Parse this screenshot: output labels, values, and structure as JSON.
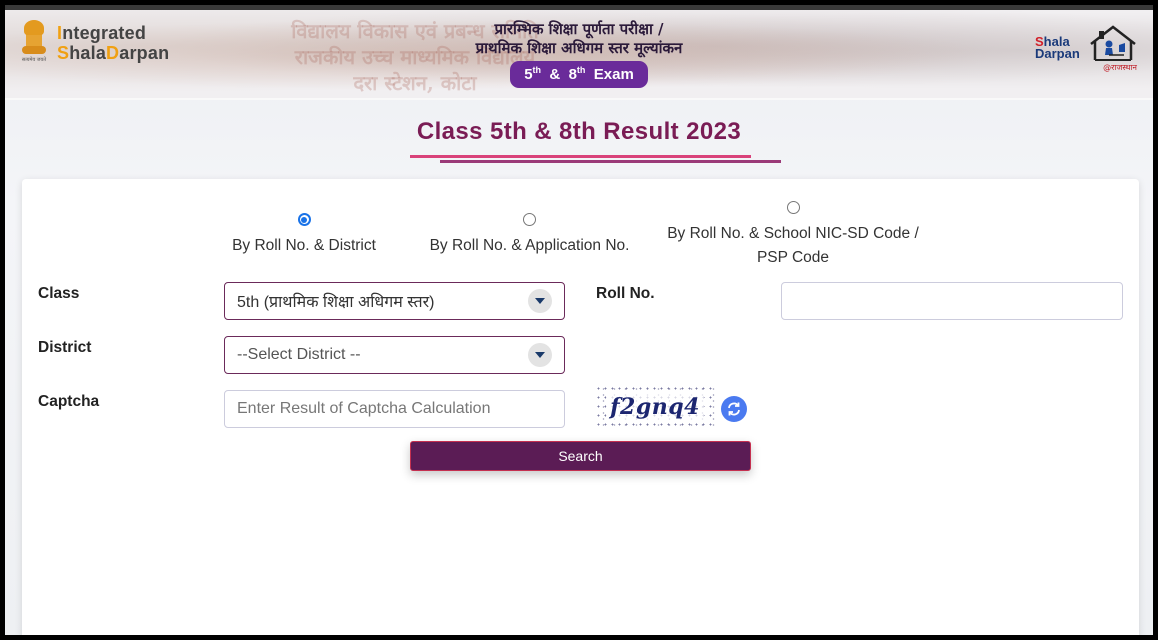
{
  "header": {
    "brand_line1_accent": "I",
    "brand_line1_rest": "ntegrated",
    "brand_line2_accent1": "S",
    "brand_line2_mid": "hala",
    "brand_line2_accent2": "D",
    "brand_line2_rest": "arpan",
    "emblem_caption": "सत्यमेव जयते",
    "hindi_title_line1": "प्रारम्भिक शिक्षा पूर्णता परीक्षा /",
    "hindi_title_line2": "प्राथमिक शिक्षा अधिगम स्तर मूल्यांकन",
    "exam_badge": {
      "n1": "5",
      "sup1": "th",
      "amp": "&",
      "n2": "8",
      "sup2": "th",
      "word": "Exam"
    },
    "right_logo": {
      "s": "S",
      "hala": "hala",
      "darpan": "Darpan",
      "sub": "@राजस्थान"
    },
    "bg_sign_lines": [
      "विद्यालय विकास एवं प्रबन्ध समिति",
      "राजकीय उच्च माध्यमिक विद्यालय",
      "दरा स्टेशन, कोटा"
    ]
  },
  "page_title": "Class 5th & 8th Result 2023",
  "search_modes": [
    {
      "label": "By Roll No. & District",
      "checked": true
    },
    {
      "label": "By Roll No. & Application No.",
      "checked": false
    },
    {
      "label_line1": "By Roll No. & School NIC-SD Code /",
      "label_line2": "PSP Code",
      "checked": false
    }
  ],
  "form": {
    "class_label": "Class",
    "class_value": "5th (प्राथमिक शिक्षा अधिगम स्तर)",
    "roll_label": "Roll No.",
    "roll_value": "",
    "district_label": "District",
    "district_value": "--Select District --",
    "captcha_label": "Captcha",
    "captcha_placeholder": "Enter Result of Captcha Calculation",
    "captcha_text": "f2gnq4",
    "search_label": "Search"
  },
  "colors": {
    "title": "#7a1c55",
    "button": "#5b1c55",
    "exam_pill": "#6a2b9a",
    "accent_orange": "#f0a012",
    "radio_checked": "#1a73e8",
    "refresh": "#4a7af0"
  }
}
